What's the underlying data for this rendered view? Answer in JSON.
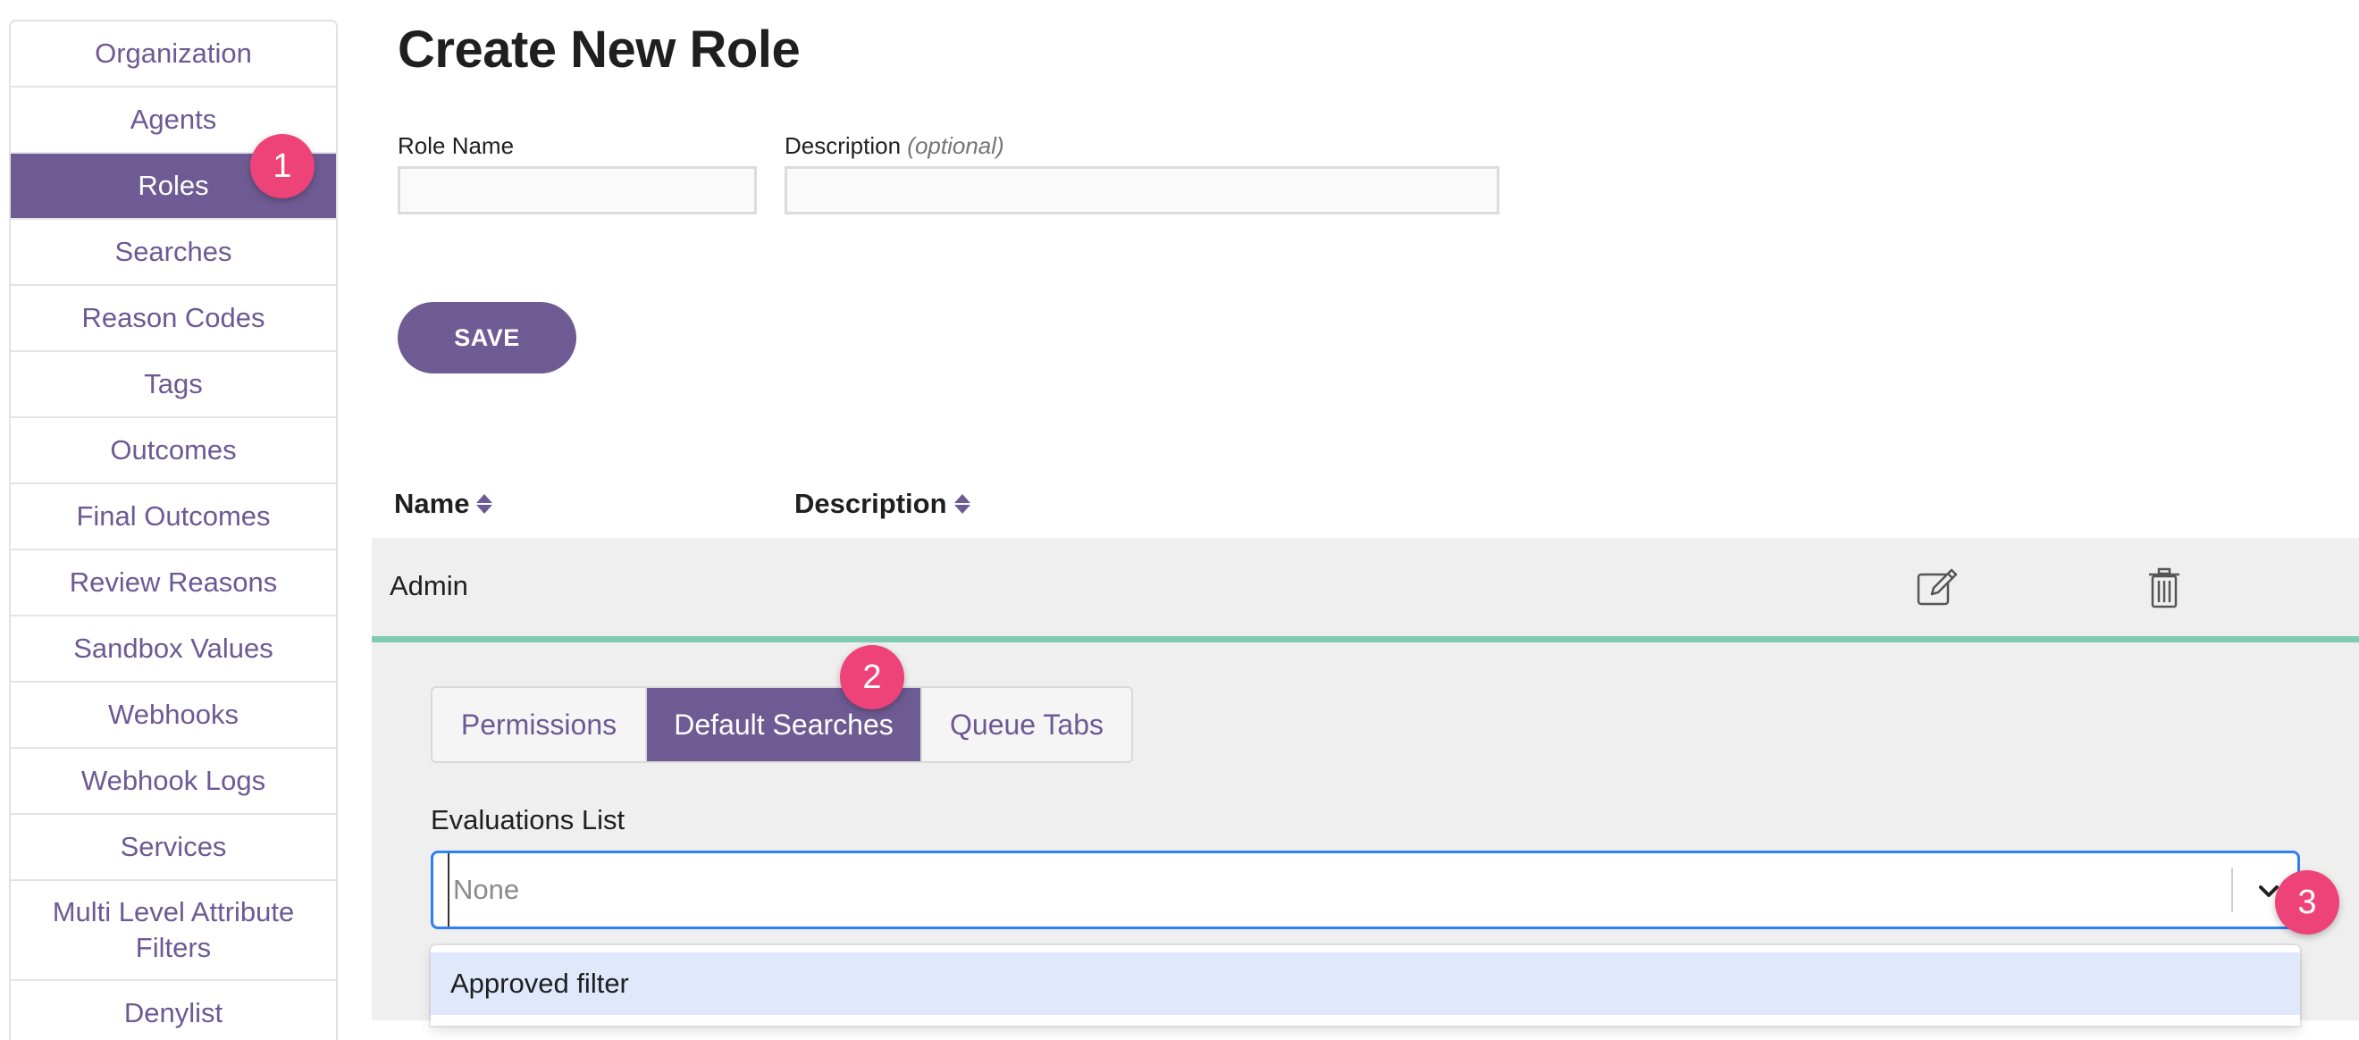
{
  "sidebar": {
    "items": [
      {
        "label": "Organization"
      },
      {
        "label": "Agents"
      },
      {
        "label": "Roles"
      },
      {
        "label": "Searches"
      },
      {
        "label": "Reason Codes"
      },
      {
        "label": "Tags"
      },
      {
        "label": "Outcomes"
      },
      {
        "label": "Final Outcomes"
      },
      {
        "label": "Review Reasons"
      },
      {
        "label": "Sandbox Values"
      },
      {
        "label": "Webhooks"
      },
      {
        "label": "Webhook Logs"
      },
      {
        "label": "Services"
      },
      {
        "label": "Multi Level Attribute Filters"
      },
      {
        "label": "Denylist"
      }
    ],
    "active_index": 2
  },
  "badges": {
    "one": "1",
    "two": "2",
    "three": "3"
  },
  "form": {
    "title": "Create New Role",
    "role_name_label": "Role Name",
    "description_label": "Description",
    "description_optional": "(optional)",
    "role_name_value": "",
    "description_value": "",
    "save_label": "SAVE"
  },
  "table": {
    "columns": [
      {
        "label": "Name"
      },
      {
        "label": "Description"
      }
    ],
    "rows": [
      {
        "name": "Admin",
        "description": ""
      }
    ]
  },
  "tabs": [
    {
      "label": "Permissions"
    },
    {
      "label": "Default Searches"
    },
    {
      "label": "Queue Tabs"
    }
  ],
  "active_tab": 1,
  "evaluations": {
    "label": "Evaluations List",
    "value": "None",
    "options": [
      {
        "label": "Approved filter"
      }
    ]
  },
  "colors": {
    "brand_purple": "#6e5b93",
    "badge_pink": "#ee4379",
    "teal_accent": "#7fcbb3",
    "focus_blue": "#2f7ff5",
    "option_highlight": "#dfe9fb"
  },
  "icons": [
    "edit-icon",
    "trash-icon",
    "sort-icon",
    "chevron-down-icon"
  ]
}
